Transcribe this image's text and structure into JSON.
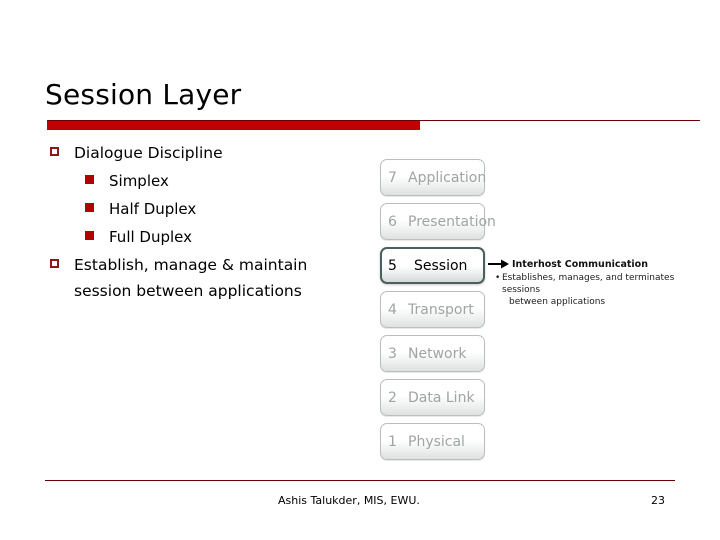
{
  "slide": {
    "title": "Session Layer",
    "accent_color": "#c00000",
    "rule_color": "#6d0000"
  },
  "content": {
    "bullets": [
      {
        "level": 1,
        "marker": "hollow-square",
        "text": "Dialogue Discipline"
      },
      {
        "level": 2,
        "marker": "filled-square",
        "text": "Simplex"
      },
      {
        "level": 2,
        "marker": "filled-square",
        "text": "Half Duplex"
      },
      {
        "level": 2,
        "marker": "filled-square",
        "text": "Full Duplex"
      },
      {
        "level": 1,
        "marker": "hollow-square",
        "text": "Establish, manage & maintain session between applications"
      }
    ]
  },
  "osi_diagram": {
    "layers": [
      {
        "number": "7",
        "name": "Application",
        "active": false
      },
      {
        "number": "6",
        "name": "Presentation",
        "active": false
      },
      {
        "number": "5",
        "name": "Session",
        "active": true
      },
      {
        "number": "4",
        "name": "Transport",
        "active": false
      },
      {
        "number": "3",
        "name": "Network",
        "active": false
      },
      {
        "number": "2",
        "name": "Data Link",
        "active": false
      },
      {
        "number": "1",
        "name": "Physical",
        "active": false
      }
    ],
    "callout": {
      "heading": "Interhost Communication",
      "detail_line1": "Establishes, manages, and terminates sessions",
      "detail_line2": "between applications"
    },
    "active_border_color": "#4b5f5f",
    "inactive_text_color": "#9ea4a4"
  },
  "footer": {
    "credit": "Ashis Talukder, MIS, EWU.",
    "page_number": "23"
  }
}
